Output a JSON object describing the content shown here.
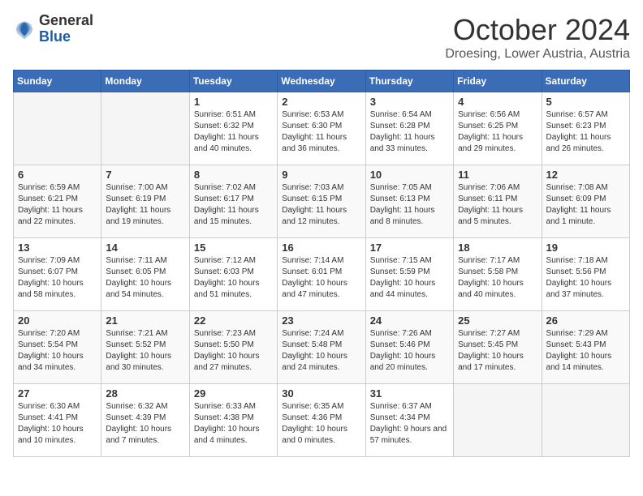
{
  "header": {
    "logo_general": "General",
    "logo_blue": "Blue",
    "month_title": "October 2024",
    "location": "Droesing, Lower Austria, Austria"
  },
  "calendar": {
    "days_of_week": [
      "Sunday",
      "Monday",
      "Tuesday",
      "Wednesday",
      "Thursday",
      "Friday",
      "Saturday"
    ],
    "weeks": [
      [
        {
          "day": "",
          "info": ""
        },
        {
          "day": "",
          "info": ""
        },
        {
          "day": "1",
          "info": "Sunrise: 6:51 AM\nSunset: 6:32 PM\nDaylight: 11 hours and 40 minutes."
        },
        {
          "day": "2",
          "info": "Sunrise: 6:53 AM\nSunset: 6:30 PM\nDaylight: 11 hours and 36 minutes."
        },
        {
          "day": "3",
          "info": "Sunrise: 6:54 AM\nSunset: 6:28 PM\nDaylight: 11 hours and 33 minutes."
        },
        {
          "day": "4",
          "info": "Sunrise: 6:56 AM\nSunset: 6:25 PM\nDaylight: 11 hours and 29 minutes."
        },
        {
          "day": "5",
          "info": "Sunrise: 6:57 AM\nSunset: 6:23 PM\nDaylight: 11 hours and 26 minutes."
        }
      ],
      [
        {
          "day": "6",
          "info": "Sunrise: 6:59 AM\nSunset: 6:21 PM\nDaylight: 11 hours and 22 minutes."
        },
        {
          "day": "7",
          "info": "Sunrise: 7:00 AM\nSunset: 6:19 PM\nDaylight: 11 hours and 19 minutes."
        },
        {
          "day": "8",
          "info": "Sunrise: 7:02 AM\nSunset: 6:17 PM\nDaylight: 11 hours and 15 minutes."
        },
        {
          "day": "9",
          "info": "Sunrise: 7:03 AM\nSunset: 6:15 PM\nDaylight: 11 hours and 12 minutes."
        },
        {
          "day": "10",
          "info": "Sunrise: 7:05 AM\nSunset: 6:13 PM\nDaylight: 11 hours and 8 minutes."
        },
        {
          "day": "11",
          "info": "Sunrise: 7:06 AM\nSunset: 6:11 PM\nDaylight: 11 hours and 5 minutes."
        },
        {
          "day": "12",
          "info": "Sunrise: 7:08 AM\nSunset: 6:09 PM\nDaylight: 11 hours and 1 minute."
        }
      ],
      [
        {
          "day": "13",
          "info": "Sunrise: 7:09 AM\nSunset: 6:07 PM\nDaylight: 10 hours and 58 minutes."
        },
        {
          "day": "14",
          "info": "Sunrise: 7:11 AM\nSunset: 6:05 PM\nDaylight: 10 hours and 54 minutes."
        },
        {
          "day": "15",
          "info": "Sunrise: 7:12 AM\nSunset: 6:03 PM\nDaylight: 10 hours and 51 minutes."
        },
        {
          "day": "16",
          "info": "Sunrise: 7:14 AM\nSunset: 6:01 PM\nDaylight: 10 hours and 47 minutes."
        },
        {
          "day": "17",
          "info": "Sunrise: 7:15 AM\nSunset: 5:59 PM\nDaylight: 10 hours and 44 minutes."
        },
        {
          "day": "18",
          "info": "Sunrise: 7:17 AM\nSunset: 5:58 PM\nDaylight: 10 hours and 40 minutes."
        },
        {
          "day": "19",
          "info": "Sunrise: 7:18 AM\nSunset: 5:56 PM\nDaylight: 10 hours and 37 minutes."
        }
      ],
      [
        {
          "day": "20",
          "info": "Sunrise: 7:20 AM\nSunset: 5:54 PM\nDaylight: 10 hours and 34 minutes."
        },
        {
          "day": "21",
          "info": "Sunrise: 7:21 AM\nSunset: 5:52 PM\nDaylight: 10 hours and 30 minutes."
        },
        {
          "day": "22",
          "info": "Sunrise: 7:23 AM\nSunset: 5:50 PM\nDaylight: 10 hours and 27 minutes."
        },
        {
          "day": "23",
          "info": "Sunrise: 7:24 AM\nSunset: 5:48 PM\nDaylight: 10 hours and 24 minutes."
        },
        {
          "day": "24",
          "info": "Sunrise: 7:26 AM\nSunset: 5:46 PM\nDaylight: 10 hours and 20 minutes."
        },
        {
          "day": "25",
          "info": "Sunrise: 7:27 AM\nSunset: 5:45 PM\nDaylight: 10 hours and 17 minutes."
        },
        {
          "day": "26",
          "info": "Sunrise: 7:29 AM\nSunset: 5:43 PM\nDaylight: 10 hours and 14 minutes."
        }
      ],
      [
        {
          "day": "27",
          "info": "Sunrise: 6:30 AM\nSunset: 4:41 PM\nDaylight: 10 hours and 10 minutes."
        },
        {
          "day": "28",
          "info": "Sunrise: 6:32 AM\nSunset: 4:39 PM\nDaylight: 10 hours and 7 minutes."
        },
        {
          "day": "29",
          "info": "Sunrise: 6:33 AM\nSunset: 4:38 PM\nDaylight: 10 hours and 4 minutes."
        },
        {
          "day": "30",
          "info": "Sunrise: 6:35 AM\nSunset: 4:36 PM\nDaylight: 10 hours and 0 minutes."
        },
        {
          "day": "31",
          "info": "Sunrise: 6:37 AM\nSunset: 4:34 PM\nDaylight: 9 hours and 57 minutes."
        },
        {
          "day": "",
          "info": ""
        },
        {
          "day": "",
          "info": ""
        }
      ]
    ]
  }
}
